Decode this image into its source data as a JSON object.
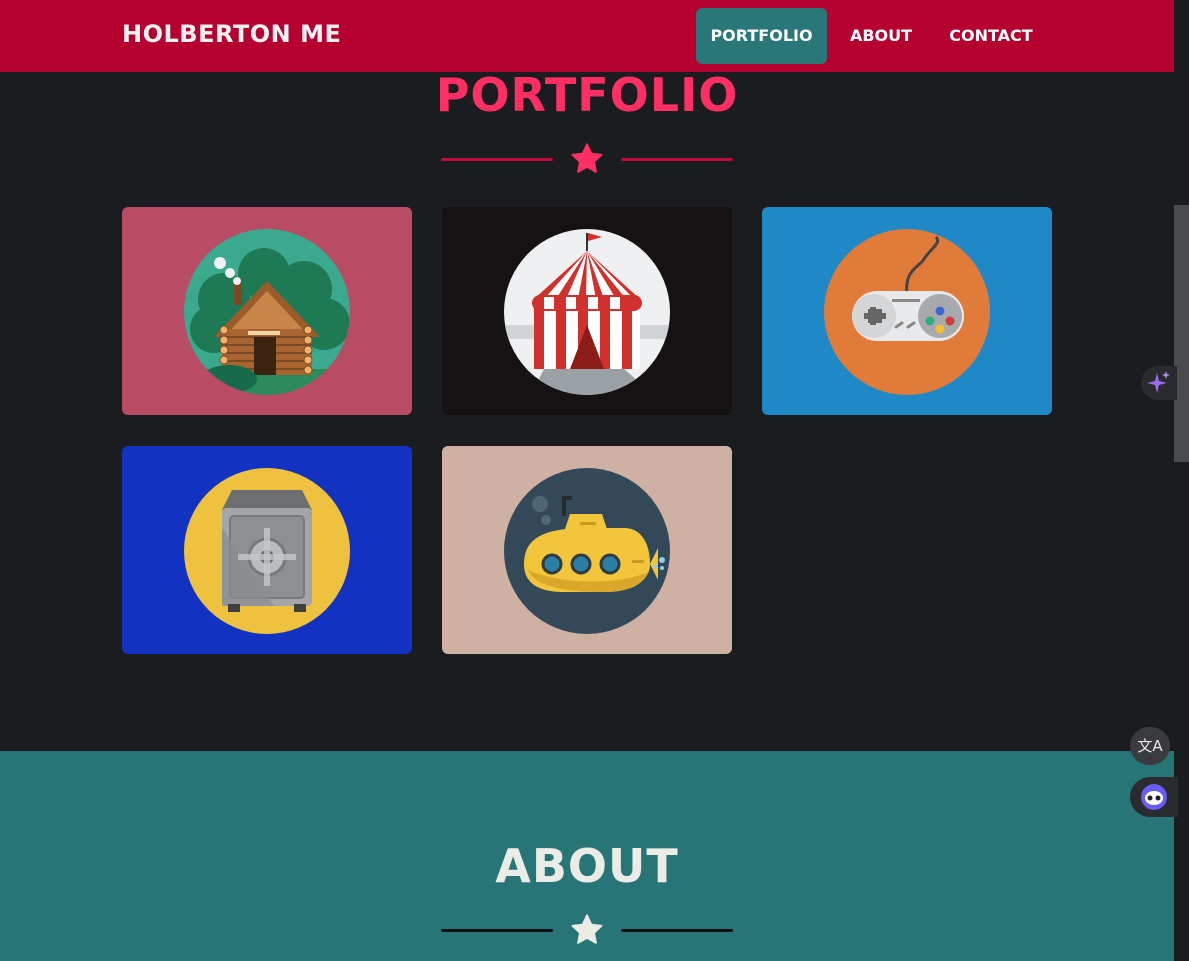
{
  "navbar": {
    "brand": "HOLBERTON ME",
    "links": [
      {
        "label": "PORTFOLIO",
        "active": true
      },
      {
        "label": "ABOUT",
        "active": false
      },
      {
        "label": "CONTACT",
        "active": false
      }
    ],
    "background": "#b6002f",
    "active_background": "#2a7779"
  },
  "portfolio": {
    "title": "PORTFOLIO",
    "accent": "#ff2e63",
    "divider_icon": "star-icon",
    "items": [
      {
        "icon": "cabin-icon",
        "background": "#b84c64"
      },
      {
        "icon": "circus-tent-icon",
        "background": "#161213"
      },
      {
        "icon": "game-controller-icon",
        "background": "#1f88c7"
      },
      {
        "icon": "safe-icon",
        "background": "#1232c1"
      },
      {
        "icon": "submarine-icon",
        "background": "#ceb1a2"
      }
    ]
  },
  "about": {
    "title": "ABOUT",
    "background": "#287578",
    "divider_icon": "star-icon"
  },
  "widgets": {
    "translate_glyph": "文A"
  }
}
